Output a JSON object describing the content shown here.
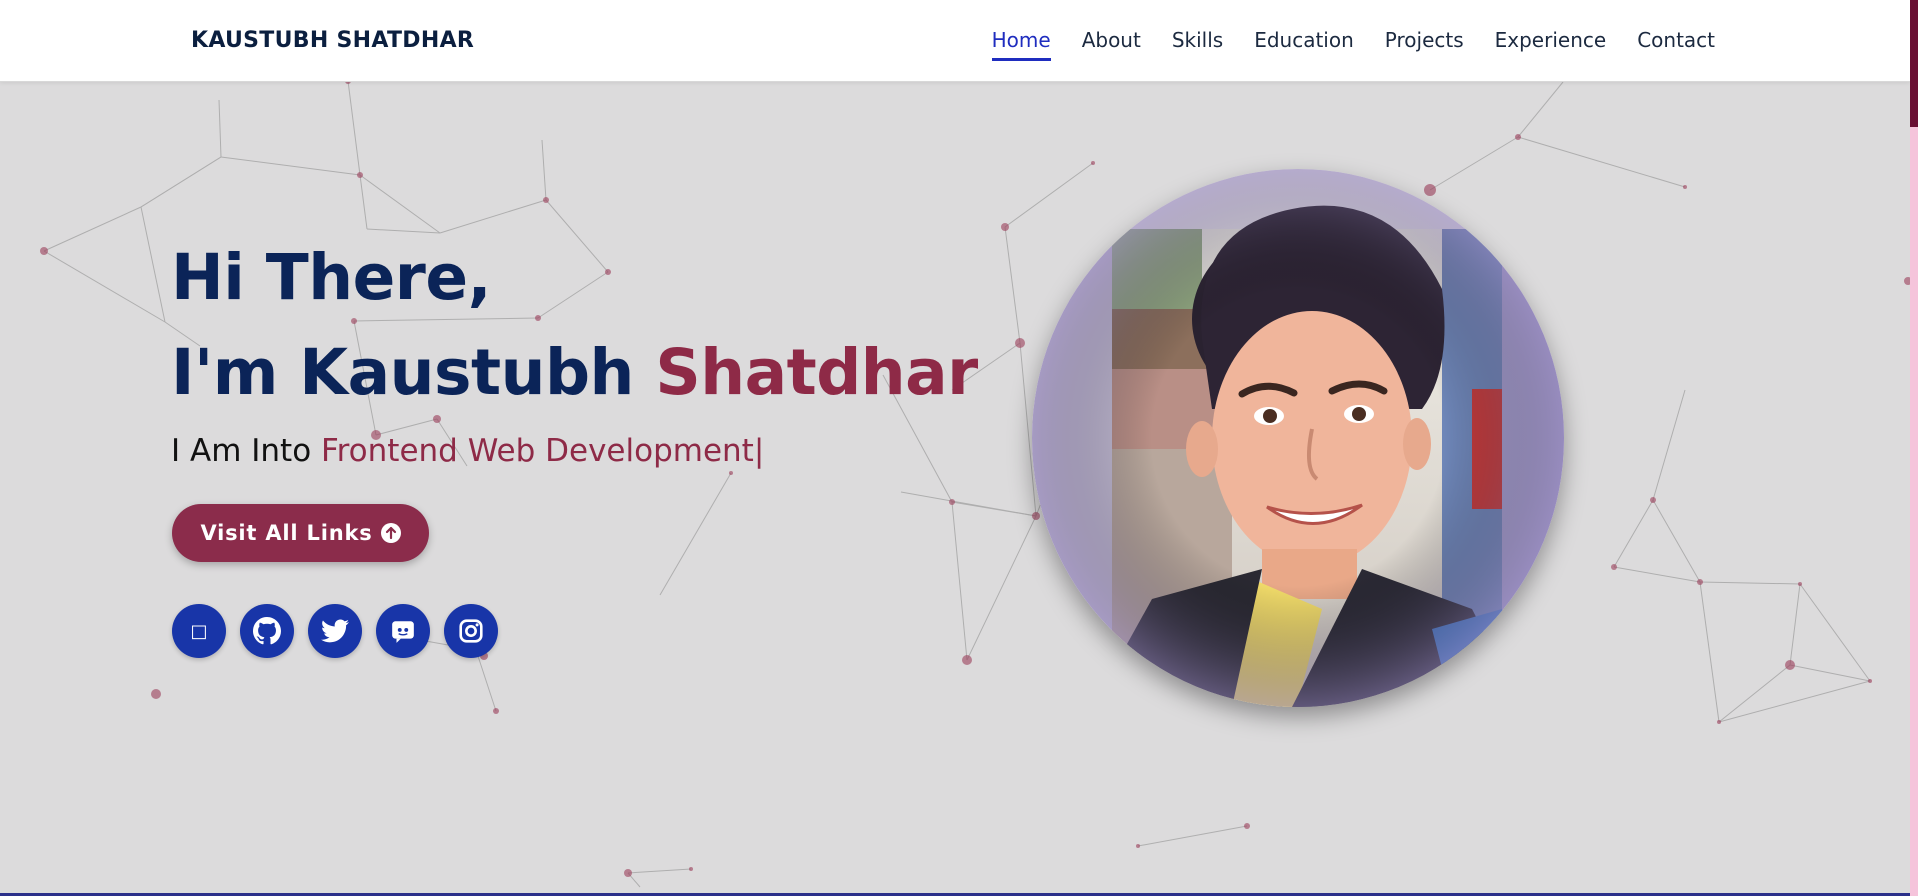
{
  "header": {
    "brand": "KAUSTUBH SHATDHAR",
    "nav": [
      {
        "label": "Home",
        "active": true
      },
      {
        "label": "About",
        "active": false
      },
      {
        "label": "Skills",
        "active": false
      },
      {
        "label": "Education",
        "active": false
      },
      {
        "label": "Projects",
        "active": false
      },
      {
        "label": "Experience",
        "active": false
      },
      {
        "label": "Contact",
        "active": false
      }
    ]
  },
  "hero": {
    "line1": "Hi There,",
    "line2_prefix": "I'm Kaustubh ",
    "line2_accent": "Shatdhar",
    "into_prefix": "I Am Into ",
    "into_accent": "Frontend Web Development",
    "cursor": "|",
    "button_label": "Visit All Links",
    "button_icon": "arrow-up-circle-icon"
  },
  "socials": [
    {
      "name": "linkedin",
      "icon": "linkedin-icon",
      "glyph": "□"
    },
    {
      "name": "github",
      "icon": "github-icon"
    },
    {
      "name": "twitter",
      "icon": "twitter-icon"
    },
    {
      "name": "discord",
      "icon": "discord-icon"
    },
    {
      "name": "instagram",
      "icon": "instagram-icon"
    }
  ],
  "photo": {
    "alt": "profile-photo"
  },
  "colors": {
    "navy": "#0b2458",
    "accent": "#8e2a47",
    "social_bg": "#1835a8",
    "nav_active": "#1f2dbf",
    "background": "#dcdbdc"
  }
}
